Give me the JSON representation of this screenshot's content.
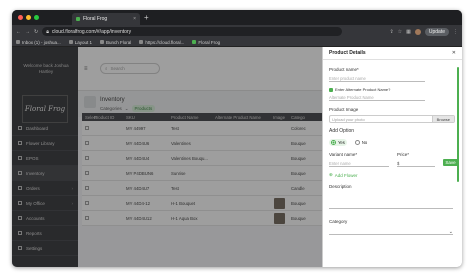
{
  "browser": {
    "tab_title": "Floral Frog",
    "url": "cloud.floralfrog.com/#/app/inventory",
    "update_label": "Update",
    "bookmarks": [
      "Inbox (1) - joshua...",
      "Layout 1",
      "Bunch Floral",
      "https://cloud.floral...",
      "Floral Frog"
    ]
  },
  "sidebar": {
    "welcome": "Welcome back Joshua Hartley",
    "logo": "Floral Frog",
    "items": [
      {
        "label": "Dashboard",
        "icon": "dashboard-icon"
      },
      {
        "label": "Flower Library",
        "icon": "library-icon"
      },
      {
        "label": "EPOS",
        "icon": "epos-icon"
      },
      {
        "label": "Inventory",
        "icon": "inventory-icon"
      },
      {
        "label": "Orders",
        "icon": "orders-icon"
      },
      {
        "label": "My Office",
        "icon": "office-icon"
      },
      {
        "label": "Accounts",
        "icon": "accounts-icon"
      },
      {
        "label": "Reports",
        "icon": "reports-icon"
      },
      {
        "label": "Settings",
        "icon": "settings-icon"
      }
    ]
  },
  "topbar": {
    "search_placeholder": "Search"
  },
  "inventory": {
    "title": "Inventory",
    "crumb_categories": "Categories",
    "crumb_products": "Products"
  },
  "table": {
    "headers": [
      "Select",
      "Product ID",
      "SKU",
      "Product Name",
      "Alternate Product Name",
      "Image",
      "Catego"
    ],
    "rows": [
      {
        "sku": "MY 44997",
        "name": "Test",
        "category": "Colorec",
        "image": false
      },
      {
        "sku": "MY 44D4U6",
        "name": "Valentines",
        "category": "Bouque",
        "image": false
      },
      {
        "sku": "MY 44D4U4",
        "name": "Valentines Bouqu...",
        "category": "Bouque",
        "image": false
      },
      {
        "sku": "MY P4DBUN6",
        "name": "Sunrise",
        "category": "Bouque",
        "image": false
      },
      {
        "sku": "MY 44D4U7",
        "name": "Test",
        "category": "Candle",
        "image": false
      },
      {
        "sku": "MY 44D4-12",
        "name": "H-1 Bouquet",
        "category": "Bouque",
        "image": true
      },
      {
        "sku": "MY 44D4U12",
        "name": "H-1 Aqua Box",
        "category": "Bouque",
        "image": true
      }
    ]
  },
  "panel": {
    "title": "Product Details",
    "product_name_label": "Product name*",
    "product_name_placeholder": "Enter product name",
    "alt_checkbox_label": "Enter Alternate Product Name?",
    "alt_name_placeholder": "Alternate Product Name",
    "image_label": "Product Image",
    "upload_placeholder": "Upload your photo",
    "browse_label": "Browse",
    "add_option_label": "Add Option",
    "radio_yes": "Yes",
    "radio_no": "No",
    "variant_label": "Variant name*",
    "variant_placeholder": "Enter name",
    "price_label": "Price*",
    "price_value": "$",
    "save_label": "Save",
    "add_flower_label": "Add Flower",
    "description_label": "Description",
    "category_label": "Category"
  }
}
